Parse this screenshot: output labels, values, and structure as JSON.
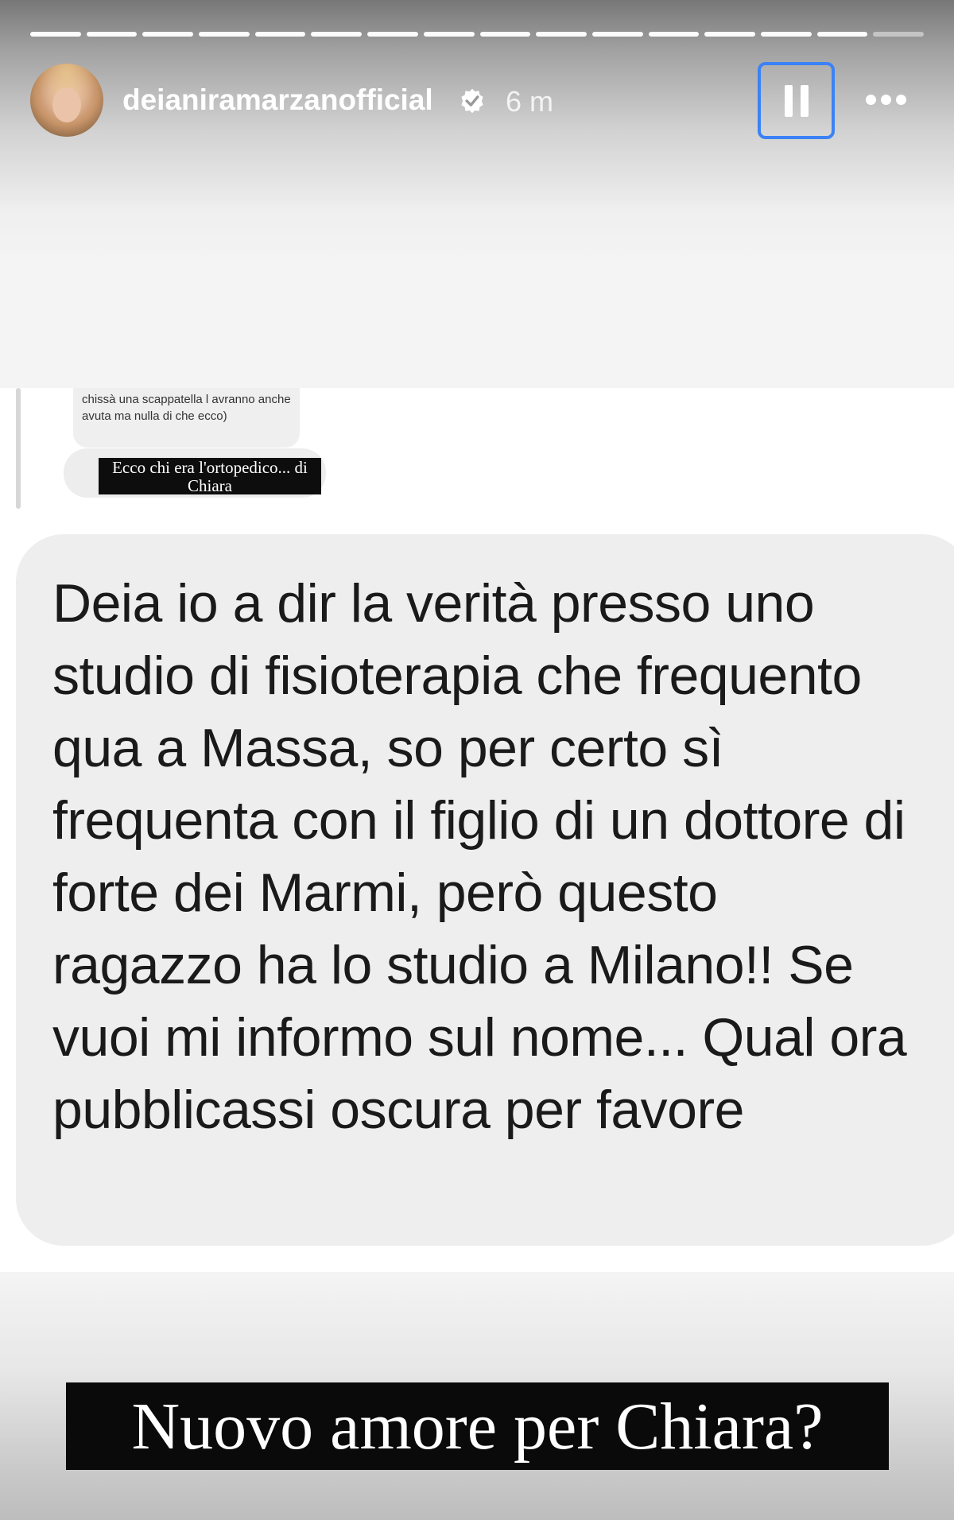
{
  "story": {
    "progress": {
      "total_segments": 16,
      "current_segment": 15
    },
    "author": {
      "username": "deianiramarzanofficial",
      "verified": true,
      "time": "6 m"
    },
    "controls": {
      "pause_icon": "pause-icon",
      "more_icon": "more-dots-icon",
      "accent_color": "#3b82f6"
    },
    "quoted_message": {
      "text": "chissà una scappatella l avranno anche avuta ma nulla di che ecco)",
      "caption": "Ecco chi era l'ortopedico... di Chiara"
    },
    "message": {
      "text": "Deia io a dir la verità presso uno studio di fisioterapia che frequento qua a Massa, so per certo sì frequenta con il figlio di un dottore di forte dei Marmi, però questo ragazzo ha lo studio a Milano!! Se vuoi mi informo sul nome... Qual ora pubblicassi oscura per favore"
    },
    "caption": "Nuovo amore per Chiara?"
  }
}
